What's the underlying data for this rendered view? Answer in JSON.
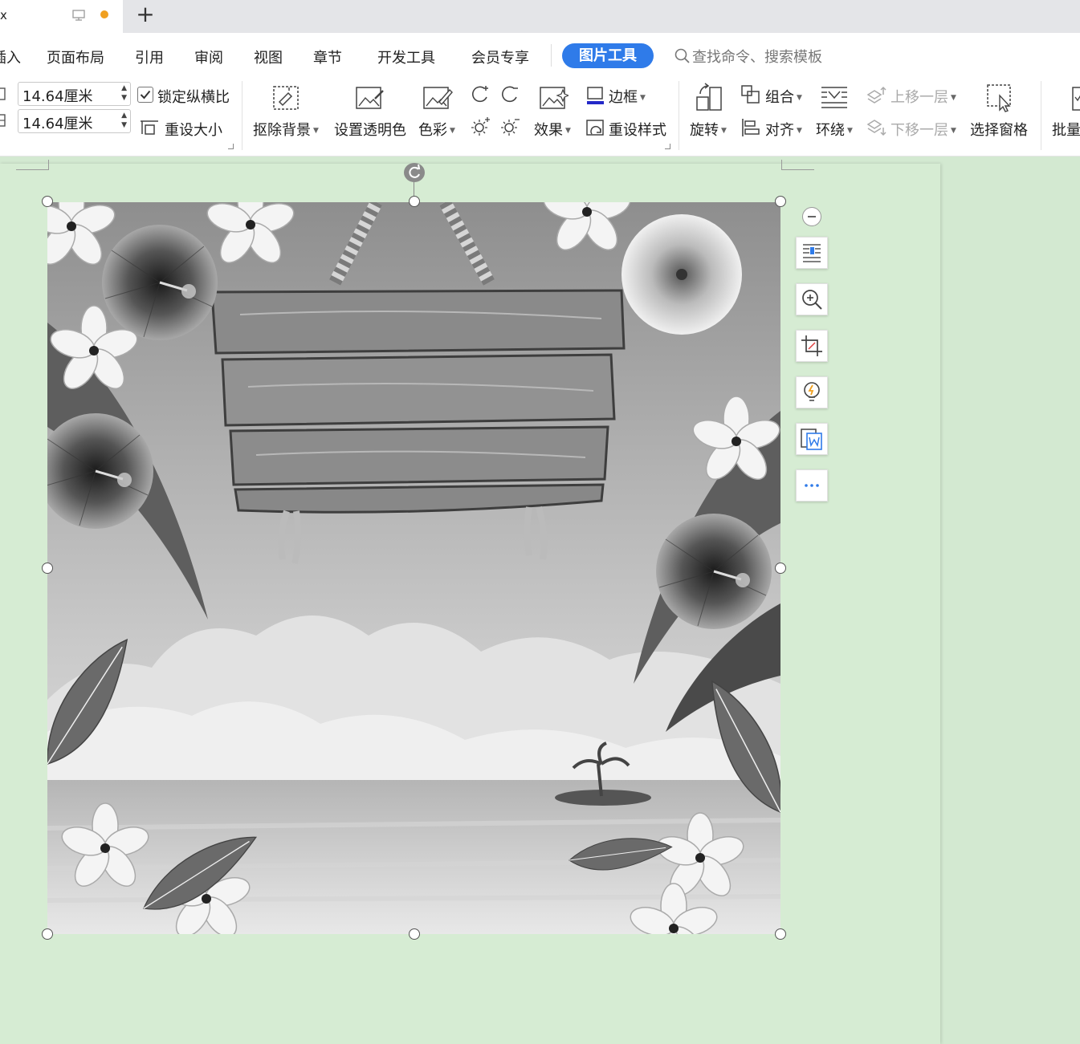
{
  "tab": {
    "title_fragment": "x"
  },
  "menu": {
    "items": [
      "插入",
      "页面布局",
      "引用",
      "审阅",
      "视图",
      "章节",
      "开发工具",
      "会员专享"
    ],
    "insert_fragment": "插入",
    "active": "图片工具",
    "search_placeholder": "查找命令、搜索模板"
  },
  "size": {
    "width": "14.64厘米",
    "height": "14.64厘米",
    "lock_ratio": "锁定纵横比",
    "reset_size": "重设大小"
  },
  "tools": {
    "remove_bg": "抠除背景",
    "set_transparent": "设置透明色",
    "color": "色彩",
    "effects": "效果",
    "border": "边框",
    "reset_style": "重设样式",
    "rotate": "旋转",
    "group": "组合",
    "align": "对齐",
    "wrap": "环绕",
    "bring_forward": "上移一层",
    "send_backward": "下移一层",
    "selection_pane": "选择窗格",
    "batch": "批量"
  },
  "colors": {
    "accent": "#2f7be9",
    "page_bg": "#d6ecd3",
    "modified_dot": "#f0a020"
  }
}
